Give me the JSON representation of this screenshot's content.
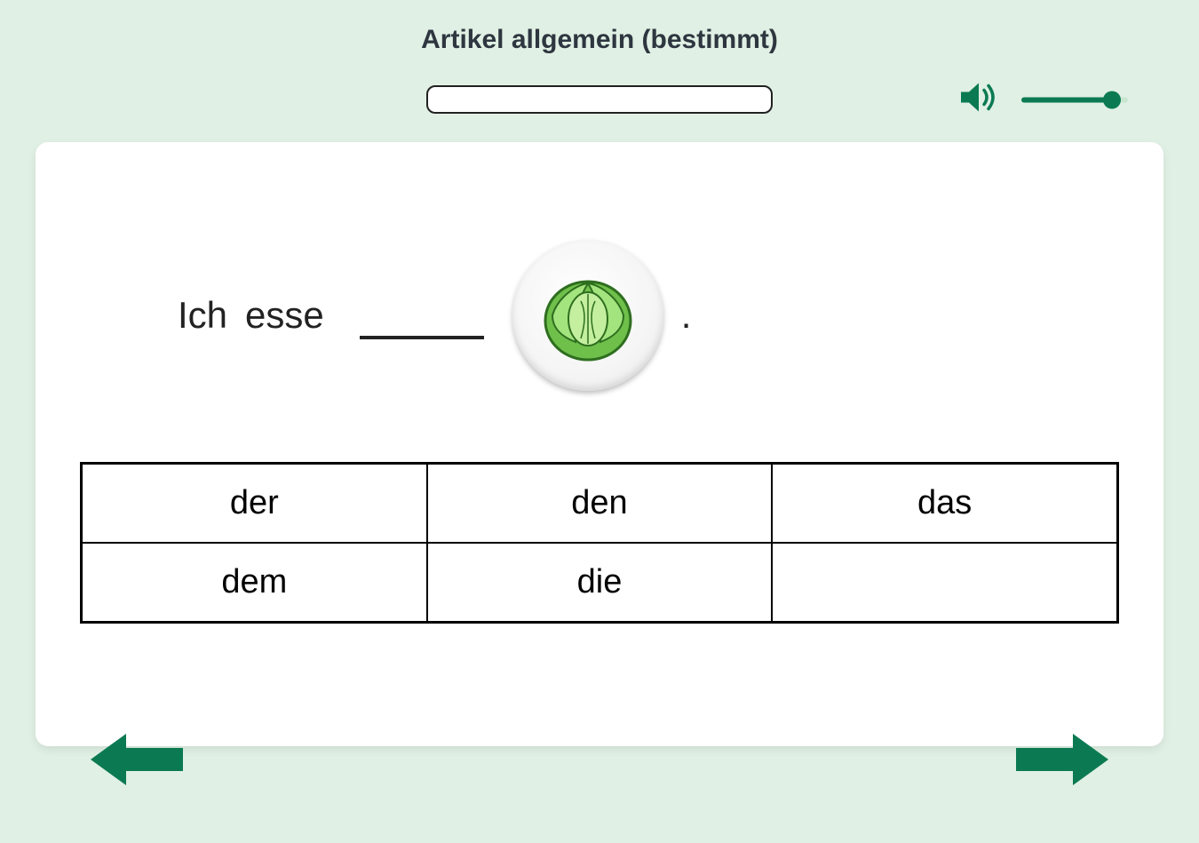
{
  "title": "Artikel allgemein (bestimmt)",
  "input_value": "",
  "colors": {
    "accent": "#0b7a53"
  },
  "volume": {
    "level": 85
  },
  "sentence": {
    "words": [
      "Ich",
      "esse"
    ],
    "blank": "",
    "object_icon": "cabbage",
    "period": "."
  },
  "options": [
    "der",
    "den",
    "das",
    "dem",
    "die",
    ""
  ]
}
